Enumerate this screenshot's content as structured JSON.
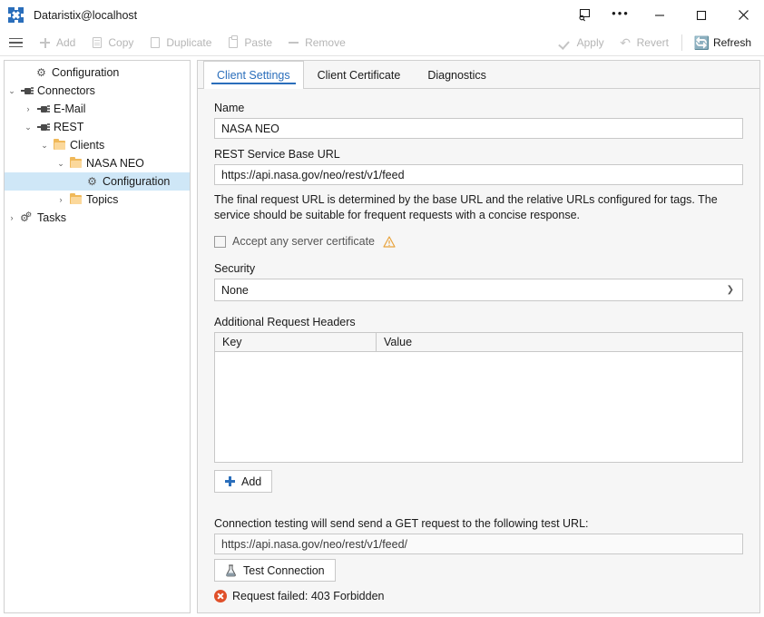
{
  "window": {
    "title": "Dataristix@localhost",
    "logo_icon": "dataristix-x-icon",
    "caption": {
      "snip_label": "snip-tool-icon",
      "more_label": "•••",
      "minimize_label": "minimize-icon",
      "maximize_label": "maximize-icon",
      "close_label": "close-icon"
    }
  },
  "toolbar": {
    "menu_icon": "hamburger-menu-icon",
    "items": [
      {
        "label": "Add",
        "icon": "plus-icon",
        "enabled": false
      },
      {
        "label": "Copy",
        "icon": "copy-icon",
        "enabled": false
      },
      {
        "label": "Duplicate",
        "icon": "duplicate-icon",
        "enabled": false
      },
      {
        "label": "Paste",
        "icon": "paste-icon",
        "enabled": false
      },
      {
        "label": "Remove",
        "icon": "minus-icon",
        "enabled": false
      }
    ],
    "right_items": [
      {
        "label": "Apply",
        "icon": "check-icon",
        "enabled": false
      },
      {
        "label": "Revert",
        "icon": "undo-icon",
        "enabled": false
      },
      {
        "label": "Refresh",
        "icon": "refresh-icon",
        "enabled": true
      }
    ]
  },
  "tree": {
    "nodes": [
      {
        "label": "Configuration",
        "icon": "gear-icon",
        "indent": 1,
        "twist": "",
        "selected": false
      },
      {
        "label": "Connectors",
        "icon": "connector-icon",
        "indent": 0,
        "twist": "⌄",
        "selected": false
      },
      {
        "label": "E-Mail",
        "icon": "connector-icon",
        "indent": 1,
        "twist": "›",
        "selected": false
      },
      {
        "label": "REST",
        "icon": "connector-icon",
        "indent": 1,
        "twist": "⌄",
        "selected": false
      },
      {
        "label": "Clients",
        "icon": "folder-icon",
        "indent": 2,
        "twist": "⌄",
        "selected": false
      },
      {
        "label": "NASA NEO",
        "icon": "folder-icon",
        "indent": 3,
        "twist": "⌄",
        "selected": false
      },
      {
        "label": "Configuration",
        "icon": "gear-icon",
        "indent": 4,
        "twist": "",
        "selected": true
      },
      {
        "label": "Topics",
        "icon": "folder-icon",
        "indent": 3,
        "twist": "›",
        "selected": false
      },
      {
        "label": "Tasks",
        "icon": "tasks-icon",
        "indent": 0,
        "twist": "›",
        "selected": false
      }
    ]
  },
  "tabs": [
    {
      "label": "Client Settings",
      "active": true
    },
    {
      "label": "Client Certificate",
      "active": false
    },
    {
      "label": "Diagnostics",
      "active": false
    }
  ],
  "form": {
    "name_label": "Name",
    "name_value": "NASA NEO",
    "base_url_label": "REST Service Base URL",
    "base_url_value": "https://api.nasa.gov/neo/rest/v1/feed",
    "help_text": "The final request URL is determined by the base URL and the relative URLs configured for tags. The service should be suitable for frequent requests with a concise response.",
    "accept_cert_label": "Accept any server certificate",
    "accept_cert_checked": false,
    "accept_cert_warning_icon": "warning-triangle-icon",
    "security_label": "Security",
    "security_value": "None",
    "headers_label": "Additional Request Headers",
    "headers_columns": [
      "Key",
      "Value"
    ],
    "headers_rows": [],
    "add_header_label": "Add",
    "test_info_text": "Connection testing will send send a GET request to the following test URL:",
    "test_url_value": "https://api.nasa.gov/neo/rest/v1/feed/",
    "test_button_label": "Test Connection",
    "test_button_icon": "flask-icon",
    "result_text": "Request failed: 403 Forbidden",
    "result_icon": "error-circle-icon"
  },
  "colors": {
    "accent": "#2a6ebb",
    "selection": "#cfe7f7",
    "panel_bg": "#f6f6f6",
    "error": "#e0502a",
    "warning": "#e8a33d",
    "folder": "#f0b95a"
  }
}
